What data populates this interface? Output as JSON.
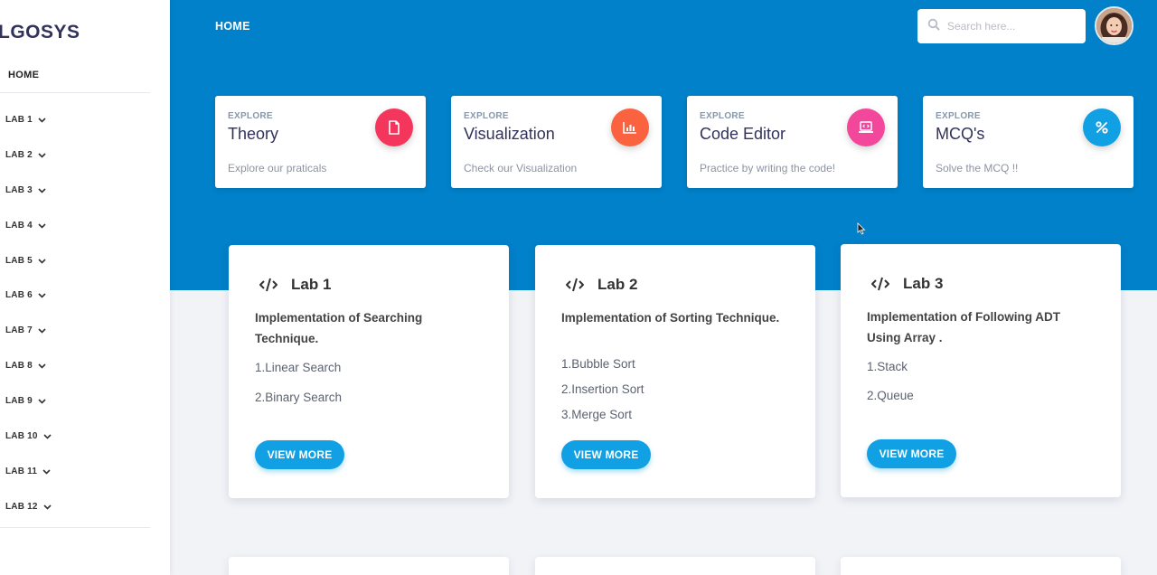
{
  "sidebar": {
    "brand": "LGOSYS",
    "home_label": "HOME",
    "items": [
      {
        "label": "LAB 1"
      },
      {
        "label": "LAB 2"
      },
      {
        "label": "LAB 3"
      },
      {
        "label": "LAB 4"
      },
      {
        "label": "LAB 5"
      },
      {
        "label": "LAB 6"
      },
      {
        "label": "LAB 7"
      },
      {
        "label": "LAB 8"
      },
      {
        "label": "LAB 9"
      },
      {
        "label": "LAB 10"
      },
      {
        "label": "LAB 11"
      },
      {
        "label": "LAB 12"
      }
    ]
  },
  "header": {
    "breadcrumb": "HOME",
    "search": {
      "placeholder": "Search here..."
    }
  },
  "stats": [
    {
      "eyebrow": "EXPLORE",
      "title": "Theory",
      "subtitle": "Explore our praticals",
      "icon": "document-icon",
      "color": "#f5365c"
    },
    {
      "eyebrow": "EXPLORE",
      "title": "Visualization",
      "subtitle": "Check our Visualization",
      "icon": "chart-bar-icon",
      "color": "#fb6340"
    },
    {
      "eyebrow": "EXPLORE",
      "title": "Code Editor",
      "subtitle": "Practice by writing the code!",
      "icon": "laptop-code-icon",
      "color": "#f3479b"
    },
    {
      "eyebrow": "EXPLORE",
      "title": "MCQ's",
      "subtitle": "Solve the MCQ !!",
      "icon": "percent-icon",
      "color": "#11a0e4"
    }
  ],
  "labs": [
    {
      "title": "Lab 1",
      "description": "Implementation of Searching Technique.",
      "topics": [
        "1.Linear Search",
        "2.Binary Search"
      ],
      "button": "VIEW MORE"
    },
    {
      "title": "Lab 2",
      "description": "Implementation of Sorting Technique.",
      "topics": [
        "1.Bubble Sort",
        "2.Insertion Sort",
        "3.Merge Sort"
      ],
      "button": "VIEW MORE"
    },
    {
      "title": "Lab 3",
      "description": "Implementation of Following ADT Using Array .",
      "topics": [
        "1.Stack",
        "2.Queue"
      ],
      "button": "VIEW MORE"
    }
  ],
  "colors": {
    "header": "#0081c9",
    "accent": "#11a0e4",
    "background": "#f1f3f7"
  }
}
